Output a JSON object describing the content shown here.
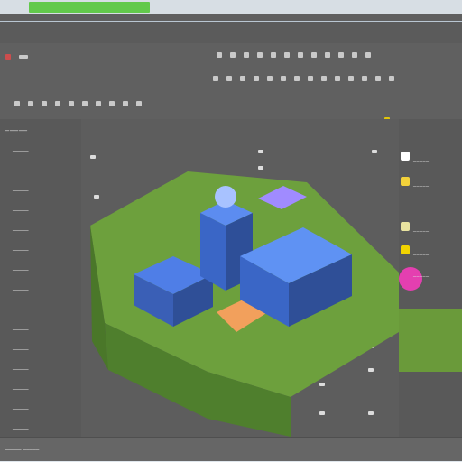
{
  "app": {
    "status_chip": "",
    "bottom_text": "_____ _____",
    "left_panel": {
      "title": "_____",
      "rows": [
        "_____",
        "_____",
        "_____",
        "_____",
        "_____",
        "_____",
        "_____",
        "_____",
        "_____",
        "_____",
        "_____",
        "_____",
        "_____",
        "_____",
        "_____"
      ]
    },
    "right_panel": {
      "items": [
        {
          "label": "_____",
          "color": "#ffffff"
        },
        {
          "label": "_____",
          "color": "#f2d13a"
        },
        {
          "label": "_____",
          "color": "#e9e3a0"
        },
        {
          "label": "_____",
          "color": "#f1d300"
        },
        {
          "label": "_____",
          "color": "#e43fb0"
        }
      ]
    },
    "colors": {
      "accent_green": "#62c94b",
      "grass": "#6a9a3a",
      "building_blue": "#3a67c7",
      "magenta": "#e43fb0"
    }
  }
}
